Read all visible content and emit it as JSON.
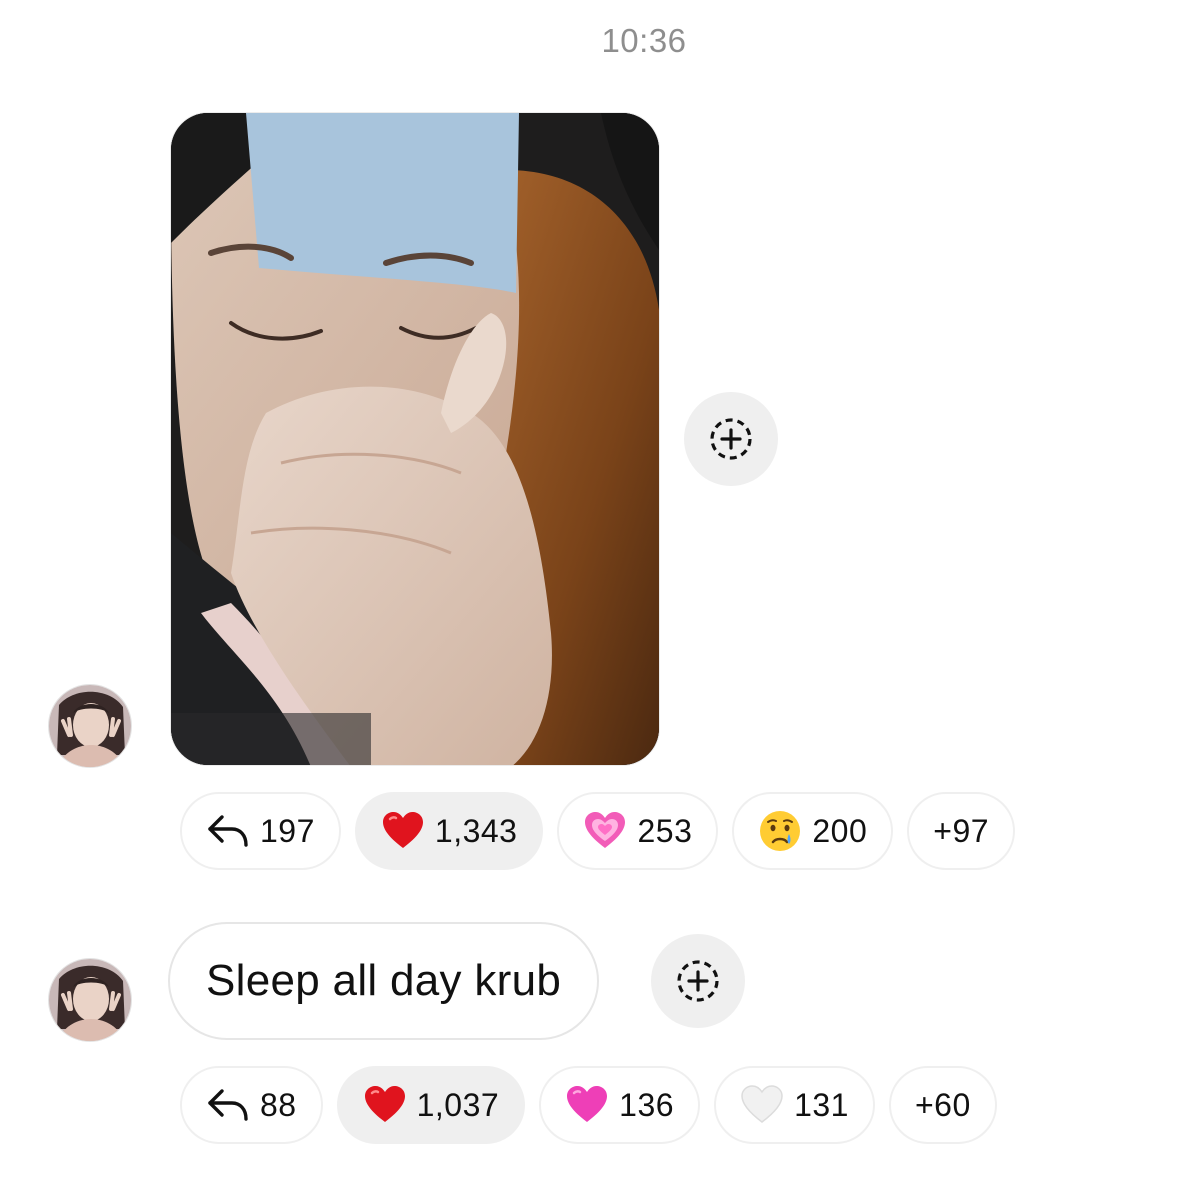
{
  "timestamp": "10:36",
  "message_photo": {
    "reactions": [
      {
        "icon": "reply-icon",
        "count": "197",
        "active": false
      },
      {
        "icon": "red-heart-icon",
        "count": "1,343",
        "active": true
      },
      {
        "icon": "sparkling-heart-icon",
        "count": "253",
        "active": false
      },
      {
        "icon": "crying-face-icon",
        "count": "200",
        "active": false
      },
      {
        "icon": "",
        "count": "+97",
        "active": false
      }
    ]
  },
  "message_text": {
    "text": "Sleep all day krub",
    "reactions": [
      {
        "icon": "reply-icon",
        "count": "88",
        "active": false
      },
      {
        "icon": "red-heart-icon",
        "count": "1,037",
        "active": true
      },
      {
        "icon": "pink-heart-icon",
        "count": "136",
        "active": false
      },
      {
        "icon": "white-heart-icon",
        "count": "131",
        "active": false
      },
      {
        "icon": "",
        "count": "+60",
        "active": false
      }
    ]
  },
  "colors": {
    "chip_border": "#efefef",
    "chip_active_bg": "#efefef",
    "timestamp": "#8e8e8e",
    "text": "#111111"
  }
}
